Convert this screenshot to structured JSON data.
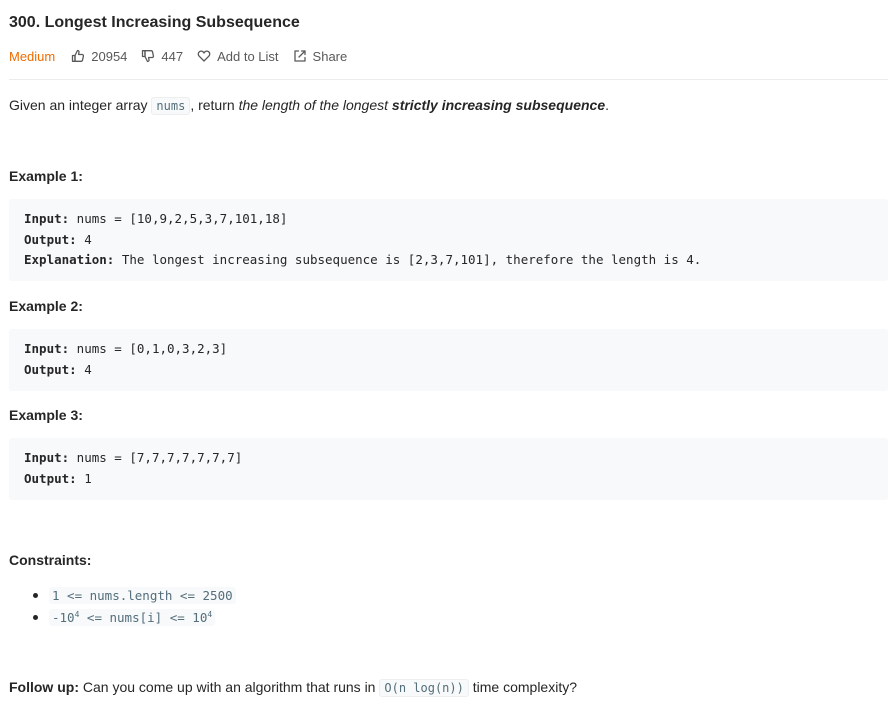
{
  "problem": {
    "title": "300. Longest Increasing Subsequence",
    "difficulty": "Medium",
    "likes": "20954",
    "dislikes": "447",
    "add_to_list": "Add to List",
    "share": "Share"
  },
  "description": {
    "prefix": "Given an integer array ",
    "code": "nums",
    "middle": ", return ",
    "italic": "the length of the longest ",
    "bold": "strictly increasing subsequence",
    "suffix": "."
  },
  "examples": [
    {
      "heading": "Example 1:",
      "input_label": "Input:",
      "input": " nums = [10,9,2,5,3,7,101,18]",
      "output_label": "Output:",
      "output": " 4",
      "explanation_label": "Explanation:",
      "explanation": " The longest increasing subsequence is [2,3,7,101], therefore the length is 4."
    },
    {
      "heading": "Example 2:",
      "input_label": "Input:",
      "input": " nums = [0,1,0,3,2,3]",
      "output_label": "Output:",
      "output": " 4"
    },
    {
      "heading": "Example 3:",
      "input_label": "Input:",
      "input": " nums = [7,7,7,7,7,7,7]",
      "output_label": "Output:",
      "output": " 1"
    }
  ],
  "constraints": {
    "heading": "Constraints:",
    "c1": "1 <= nums.length <= 2500",
    "c2_a": "-10",
    "c2_exp1": "4",
    "c2_b": " <= nums[i] <= 10",
    "c2_exp2": "4"
  },
  "follow_up": {
    "label": "Follow up:",
    "text_a": " Can you come up with an algorithm that runs in ",
    "code": "O(n log(n))",
    "text_b": " time complexity?"
  }
}
